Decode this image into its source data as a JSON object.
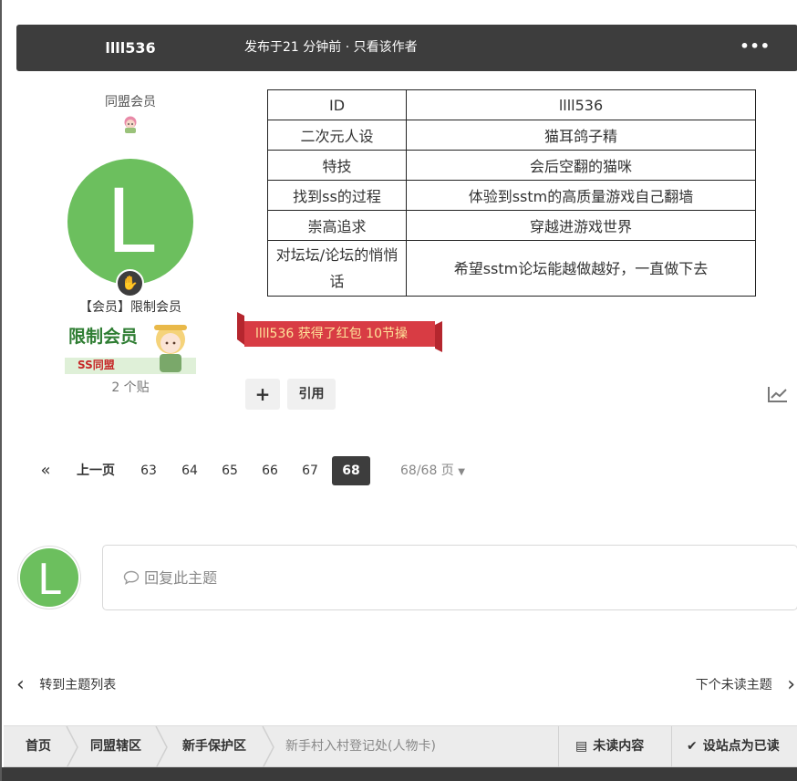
{
  "post": {
    "author": "llll536",
    "meta": "发布于21 分钟前 · 只看该作者",
    "more_icon": "•••"
  },
  "author_panel": {
    "group_title": "同盟会员",
    "avatar_letter": "L",
    "rank_title": "【会员】限制会员",
    "rank_image_text": "限制会员",
    "rank_image_sub": "SS同盟",
    "post_count": "2 个贴"
  },
  "profile_table": [
    {
      "key": "ID",
      "value": "llll536"
    },
    {
      "key": "二次元人设",
      "value": "猫耳鸽子精"
    },
    {
      "key": "特技",
      "value": "会后空翻的猫咪"
    },
    {
      "key": "找到ss的过程",
      "value": "体验到sstm的高质量游戏自己翻墙"
    },
    {
      "key": "崇高追求",
      "value": "穿越进游戏世界"
    },
    {
      "key": "对坛坛/论坛的悄悄话",
      "value": "希望sstm论坛能越做越好，一直做下去"
    }
  ],
  "reward": {
    "text": "llll536 获得了红包 10节操"
  },
  "actions": {
    "plus": "+",
    "quote": "引用"
  },
  "pagination": {
    "first": "«",
    "prev": "上一页",
    "pages": [
      "63",
      "64",
      "65",
      "66",
      "67",
      "68"
    ],
    "active": "68",
    "info": "68/68 页"
  },
  "reply": {
    "avatar_letter": "L",
    "placeholder": "回复此主题"
  },
  "topic_nav": {
    "prev": "转到主题列表",
    "next": "下个未读主题"
  },
  "breadcrumb": {
    "items": [
      "首页",
      "同盟辖区",
      "新手保护区",
      "新手村入村登记处(人物卡)"
    ],
    "unread": "未读内容",
    "mark_read": "设站点为已读"
  },
  "colors": {
    "header_bg": "#3d3d3d",
    "avatar_green": "#6cbf5e",
    "ribbon_red": "#d83c44",
    "ribbon_text": "#ffe39a"
  }
}
